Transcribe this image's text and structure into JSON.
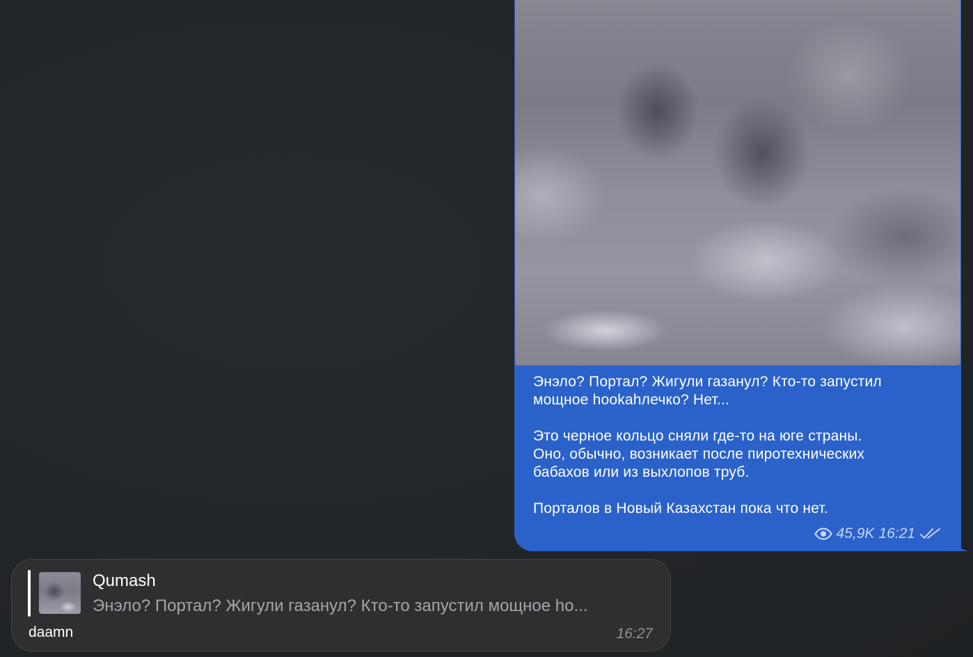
{
  "channel_post": {
    "caption_lines": [
      "Энэло? Портал? Жигули газанул? Кто-то запустил",
      "мощное hookahлечко? Нет...",
      "",
      "Это черное кольцо сняли где-то на юге страны.",
      "Оно, обычно, возникает после пиротехнических",
      "бабахов или из выхлопов труб.",
      "",
      "Порталов в Новый Казахстан пока что нет."
    ],
    "views": "45,9K",
    "time": "16:21",
    "view_icon": "eye-icon",
    "status_icon": "double-check-icon",
    "bubble_color": "#2b62c9"
  },
  "reply_message": {
    "quote": {
      "author": "Qumash",
      "text": "Энэло? Портал? Жигули газанул? Кто-то запустил мощное ho..."
    },
    "text": "daamn",
    "time": "16:27",
    "bubble_color": "#2f2f31"
  }
}
